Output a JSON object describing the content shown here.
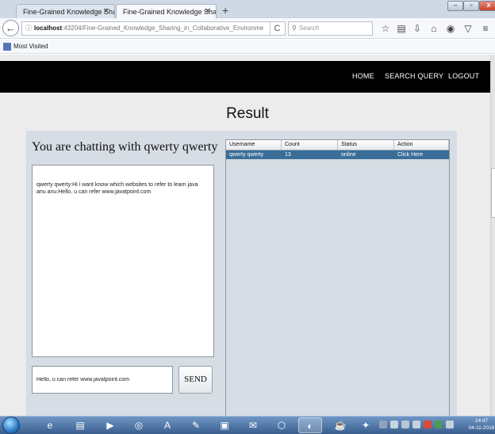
{
  "browser": {
    "tabs": [
      {
        "label": "Fine-Grained Knowledge Shari..."
      },
      {
        "label": "Fine-Grained Knowledge Shari..."
      }
    ],
    "url_host": "localhost",
    "url_rest": ":43204/Fine-Grained_Knowledge_Sharing_in_Collaborative_Environme",
    "search_placeholder": "Search",
    "bookmarks": {
      "most_visited": "Most Visited"
    }
  },
  "nav": {
    "home": "HOME",
    "search_query": "SEARCH QUERY",
    "logout": "LOGOUT"
  },
  "page_title": "Result",
  "chat": {
    "heading": "You are chatting with qwerty qwerty",
    "messages": [
      "qwerty qwerty:Hi i want know which websites to refer to learn java",
      "anu anu:Hello, u can refer www.javatpoint.com"
    ],
    "input_value": "Hello, u can refer www.javatpoint.com",
    "send_label": "SEND"
  },
  "users_table": {
    "headers": [
      "Username",
      "Count",
      "Status",
      "Action"
    ],
    "rows": [
      {
        "username": "qwerty qwerty",
        "count": "13",
        "status": "online",
        "action": "Click Here"
      }
    ]
  },
  "taskbar": {
    "time": "14:47",
    "date": "04-11-2016"
  },
  "colors": {
    "nav_bg": "#000000",
    "panel_bg": "#d6dde4",
    "selected_row": "#3a6d98"
  }
}
